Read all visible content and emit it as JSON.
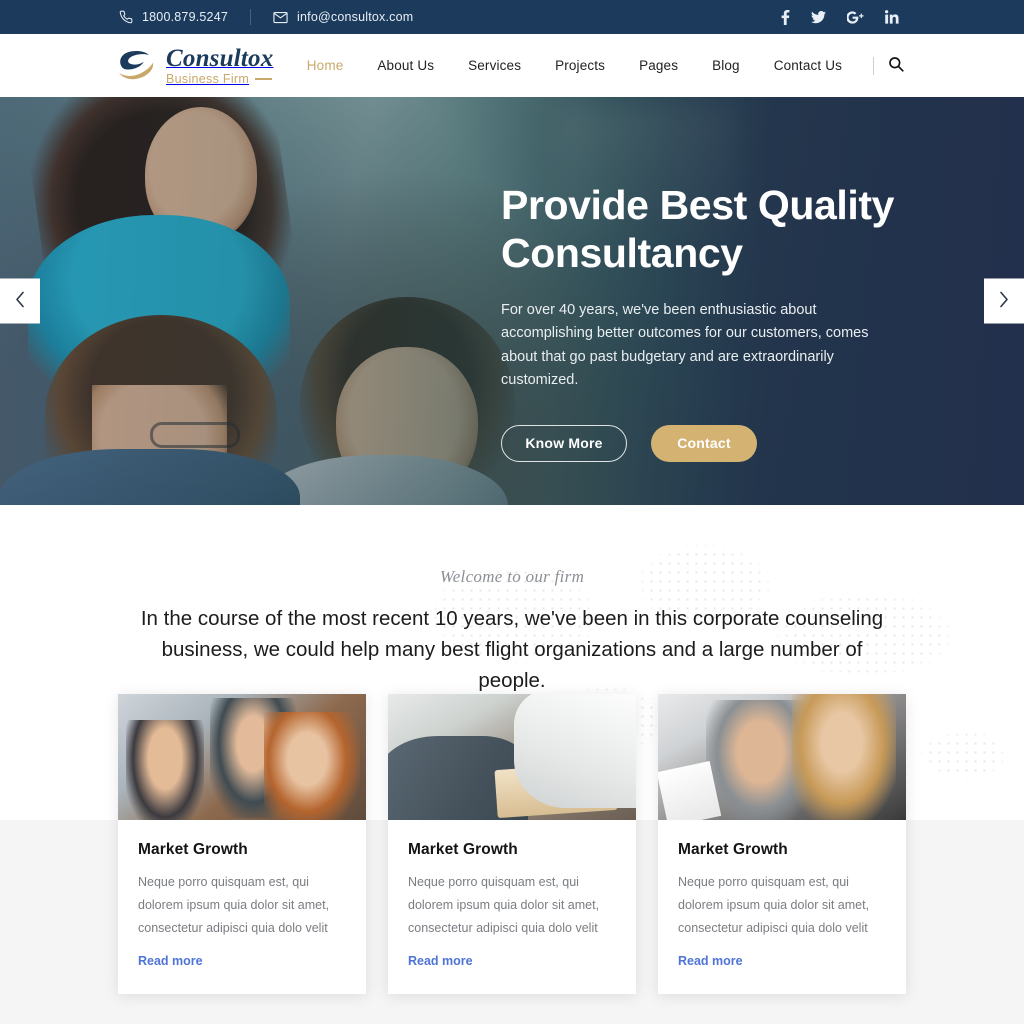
{
  "topbar": {
    "phone": "1800.879.5247",
    "email": "info@consultox.com",
    "phone_icon": "phone-icon",
    "email_icon": "envelope-icon",
    "socials": [
      {
        "name": "facebook-icon",
        "label": "f"
      },
      {
        "name": "twitter-icon",
        "label": "t"
      },
      {
        "name": "google-plus-icon",
        "label": "G+"
      },
      {
        "name": "linkedin-icon",
        "label": "in"
      }
    ]
  },
  "header": {
    "logo_name": "Consultox",
    "logo_sub": "Business Firm",
    "nav": [
      {
        "label": "Home",
        "active": true
      },
      {
        "label": "About Us",
        "active": false
      },
      {
        "label": "Services",
        "active": false
      },
      {
        "label": "Projects",
        "active": false
      },
      {
        "label": "Pages",
        "active": false
      },
      {
        "label": "Blog",
        "active": false
      },
      {
        "label": "Contact Us",
        "active": false
      }
    ],
    "search_icon": "search-icon"
  },
  "hero": {
    "title": "Provide Best Quality Consultancy",
    "subtitle": "For over 40 years, we've been enthusiastic about accomplishing better outcomes for our customers, comes about that go past budgetary and are extraordinarily customized.",
    "primary_button": "Know More",
    "secondary_button": "Contact",
    "prev_label": "‹",
    "next_label": "›"
  },
  "welcome": {
    "eyebrow": "Welcome to our firm",
    "headline": "In the course of the most recent 10 years, we've been in this corporate counseling business, we could help many best flight organizations and a large number of people."
  },
  "cards": [
    {
      "title": "Market Growth",
      "text": "Neque porro quisquam est, qui dolorem ipsum quia dolor sit amet, consectetur adipisci quia dolo velit",
      "link": "Read more"
    },
    {
      "title": "Market Growth",
      "text": "Neque porro quisquam est, qui dolorem ipsum quia dolor sit amet, consectetur adipisci quia dolo velit",
      "link": "Read more"
    },
    {
      "title": "Market Growth",
      "text": "Neque porro quisquam est, qui dolorem ipsum quia dolor sit amet, consectetur adipisci quia dolo velit",
      "link": "Read more"
    }
  ],
  "colors": {
    "navy": "#1b3a5c",
    "gold": "#c9a96a",
    "gold_button": "#d3b272",
    "link_blue": "#4f74d6",
    "band_gray": "#f5f5f6"
  }
}
